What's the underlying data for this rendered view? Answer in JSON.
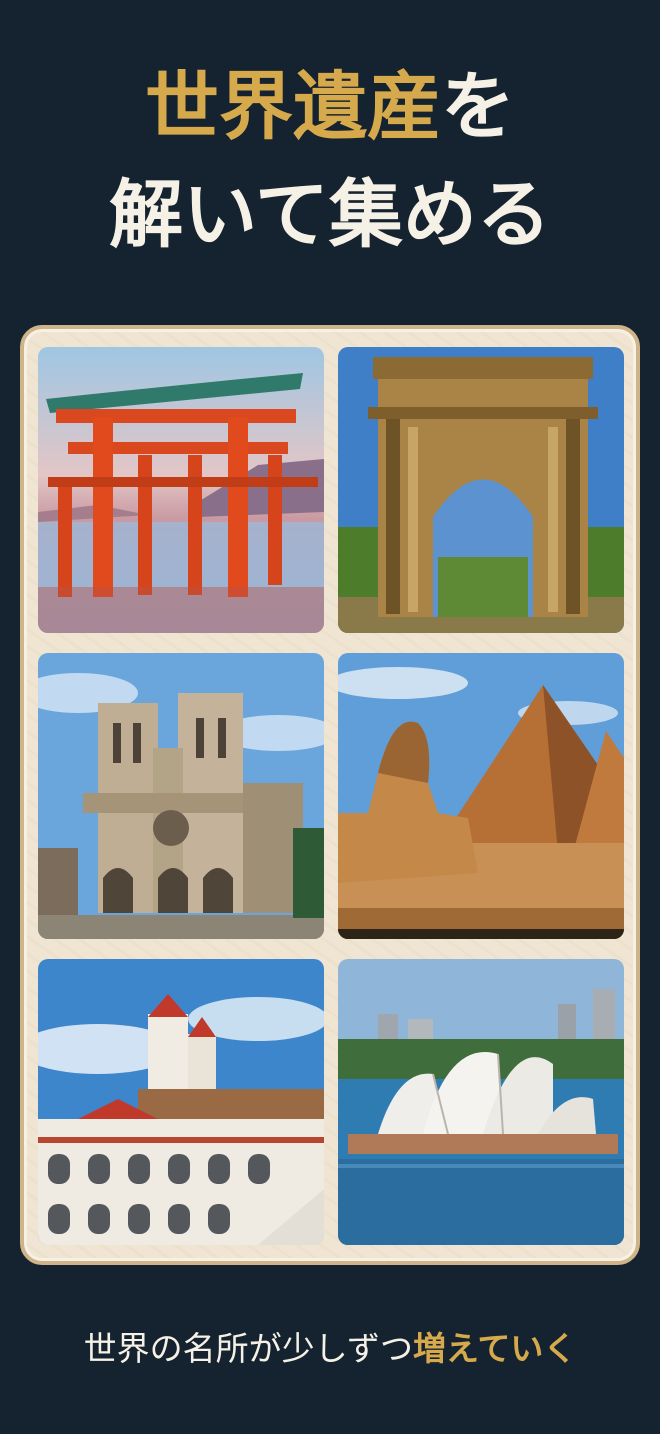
{
  "headline": {
    "line1_gold": "世界遺産",
    "line1_white": "を",
    "line2": "解いて集める"
  },
  "gallery": {
    "tiles": [
      {
        "icon": "torii-gate-image"
      },
      {
        "icon": "triumphal-arch-image"
      },
      {
        "icon": "cathedral-image"
      },
      {
        "icon": "sphinx-pyramids-image"
      },
      {
        "icon": "colonial-church-image"
      },
      {
        "icon": "opera-house-image"
      }
    ]
  },
  "caption": {
    "text_white": "世界の名所が少しずつ",
    "text_gold": "増えていく"
  },
  "colors": {
    "background": "#14232f",
    "accent_gold": "#d6aa4c",
    "text_cream": "#f6f1e6",
    "frame": "#efe5d2"
  }
}
